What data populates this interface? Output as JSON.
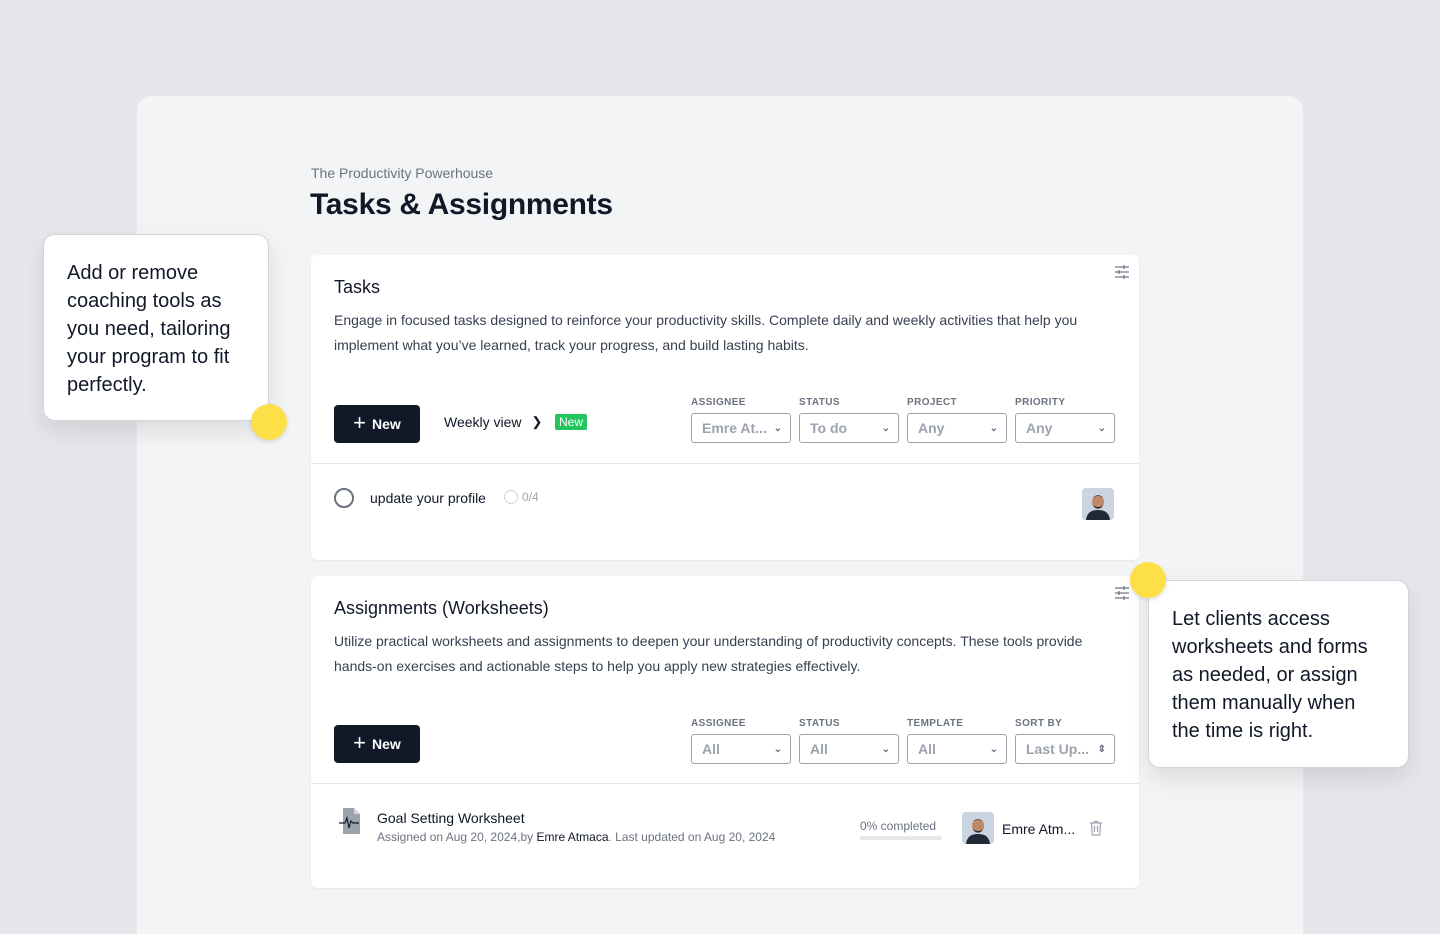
{
  "header": {
    "breadcrumb": "The Productivity Powerhouse",
    "title": "Tasks & Assignments"
  },
  "tasks": {
    "title": "Tasks",
    "description": "Engage in focused tasks designed to reinforce your productivity skills. Complete daily and weekly activities that help you implement what you’ve learned, track your progress, and build lasting habits.",
    "new_label": "New",
    "weekly_label": "Weekly view",
    "weekly_badge": "New",
    "filters": [
      {
        "label": "ASSIGNEE",
        "value": "Emre At..."
      },
      {
        "label": "STATUS",
        "value": "To do"
      },
      {
        "label": "PROJECT",
        "value": "Any"
      },
      {
        "label": "PRIORITY",
        "value": "Any"
      }
    ],
    "items": [
      {
        "name": "update your profile",
        "progress": "0/4"
      }
    ]
  },
  "assignments": {
    "title": "Assignments (Worksheets)",
    "description": "Utilize practical worksheets and assignments to deepen your understanding of productivity concepts. These tools provide hands-on exercises and actionable steps to help you apply new strategies effectively.",
    "new_label": "New",
    "filters": [
      {
        "label": "ASSIGNEE",
        "value": "All"
      },
      {
        "label": "STATUS",
        "value": "All"
      },
      {
        "label": "TEMPLATE",
        "value": "All"
      },
      {
        "label": "SORT BY",
        "value": "Last Up..."
      }
    ],
    "items": [
      {
        "title": "Goal Setting Worksheet",
        "meta_prefix": "Assigned on Aug 20, 2024,by ",
        "meta_who": "Emre Atmaca",
        "meta_suffix": ". Last updated on Aug 20, 2024",
        "completed_label": "0% completed",
        "completed_fraction": 0,
        "user": "Emre Atm..."
      }
    ]
  },
  "callouts": {
    "left": "Add or remove coaching tools as you need, tailoring your program to fit perfectly.",
    "right": "Let clients access worksheets and forms as needed, or assign them manually when the time is right."
  },
  "colors": {
    "accent_dot": "#fde047",
    "badge_green": "#22c55e",
    "button_dark": "#111827"
  }
}
